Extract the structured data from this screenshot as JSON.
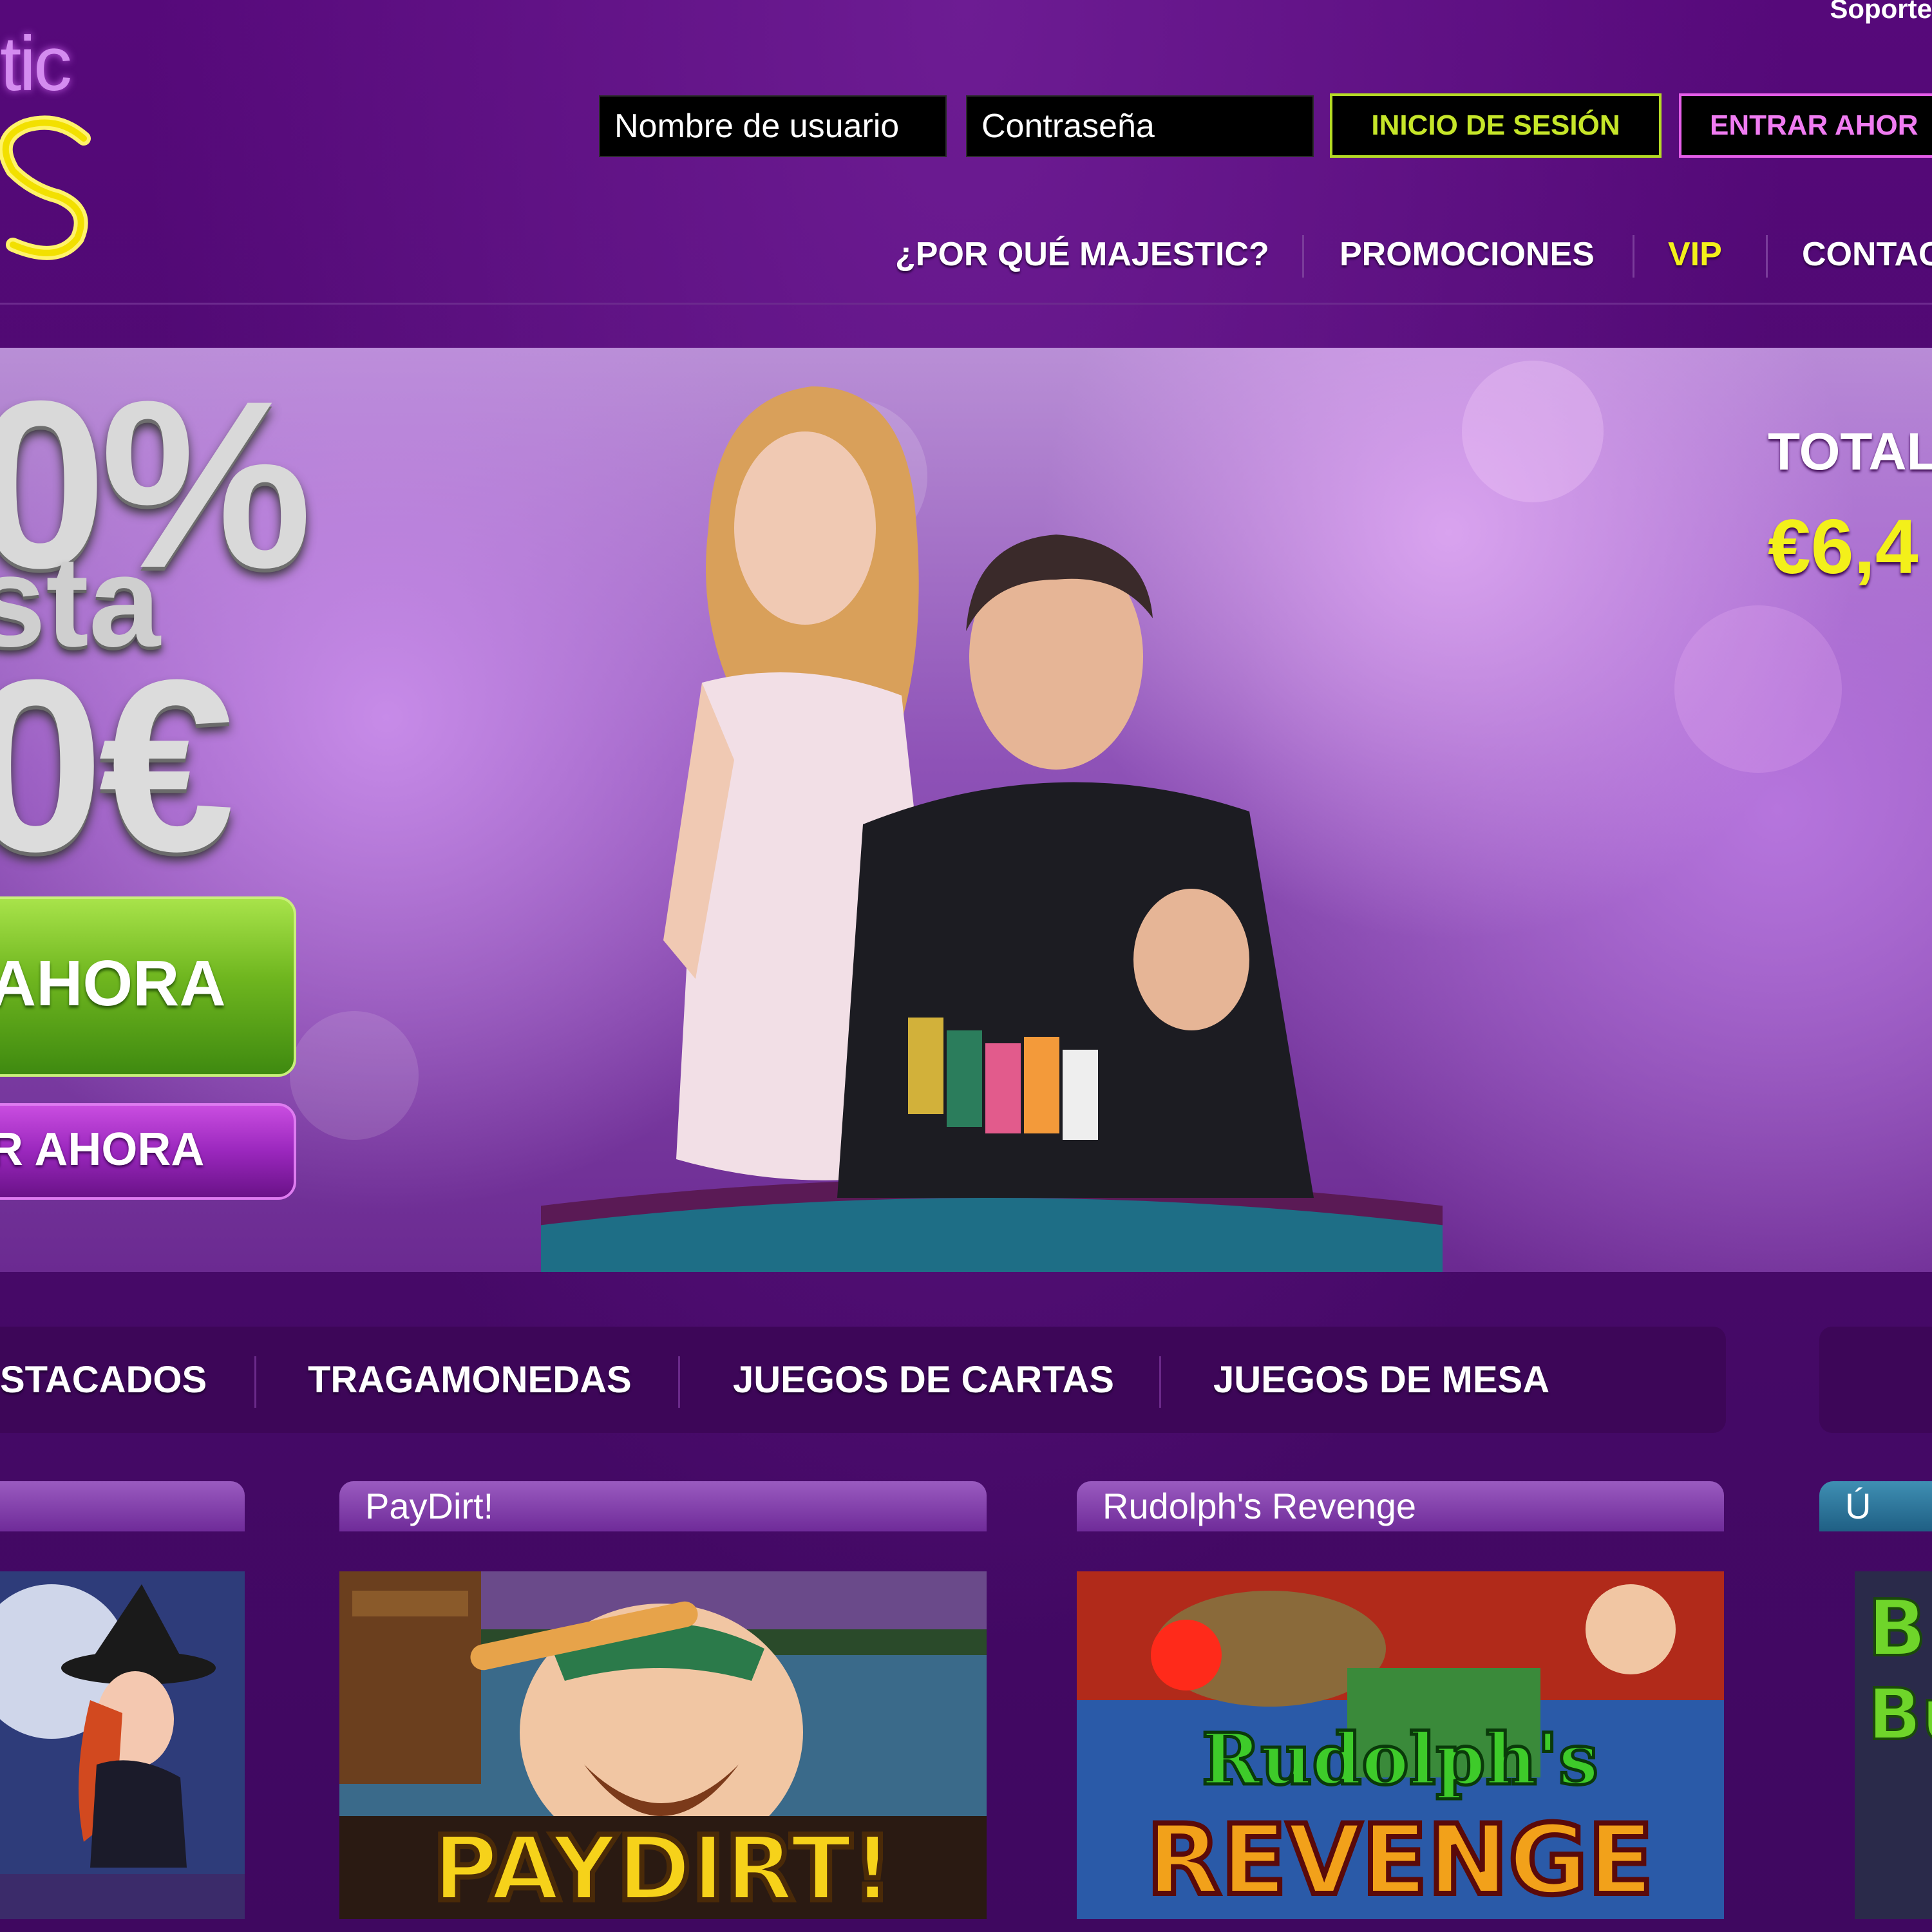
{
  "brand": {
    "logo_text": "tic",
    "accent": "#c6e629",
    "secondary_accent": "#f07cf2",
    "background": "#4a0a6e"
  },
  "header": {
    "support_link": "Soporte",
    "username_placeholder": "Nombre de usuario",
    "password_placeholder": "Contraseña",
    "login_label": "INICIO DE SESIÓN",
    "join_label": "ENTRAR AHOR"
  },
  "nav": {
    "items": [
      {
        "label": "¿POR QUÉ MAJESTIC?",
        "color": "#ffffff"
      },
      {
        "label": "PROMOCIONES",
        "color": "#ffffff"
      },
      {
        "label": "VIP",
        "color": "#f3f01a"
      },
      {
        "label": "CONTAC",
        "color": "#ffffff"
      }
    ]
  },
  "hero": {
    "bonus_percent": "0%",
    "bonus_hasta": "sta",
    "bonus_amount": "0€",
    "cta_primary": "AHORA",
    "cta_secondary": "R AHORA",
    "jackpot_label": "TOTAL",
    "jackpot_value": "€6,4"
  },
  "game_tabs": [
    {
      "label": "STACADOS"
    },
    {
      "label": "TRAGAMONEDAS"
    },
    {
      "label": "JUEGOS DE CARTAS"
    },
    {
      "label": "JUEGOS DE MESA"
    }
  ],
  "games": [
    {
      "title": "",
      "art_text": "",
      "icon": "witch-slot-thumbnail"
    },
    {
      "title": "PayDirt!",
      "art_text": "PAYDIRT!",
      "icon": "miner-slot-thumbnail"
    },
    {
      "title": "Rudolph's Revenge",
      "art_text_top": "Rudolph's",
      "art_text_bottom": "REVENGE",
      "icon": "reindeer-slot-thumbnail"
    },
    {
      "title": "Ú",
      "art_text": "B",
      "art_text2": "Bu",
      "icon": "game-thumbnail"
    }
  ]
}
